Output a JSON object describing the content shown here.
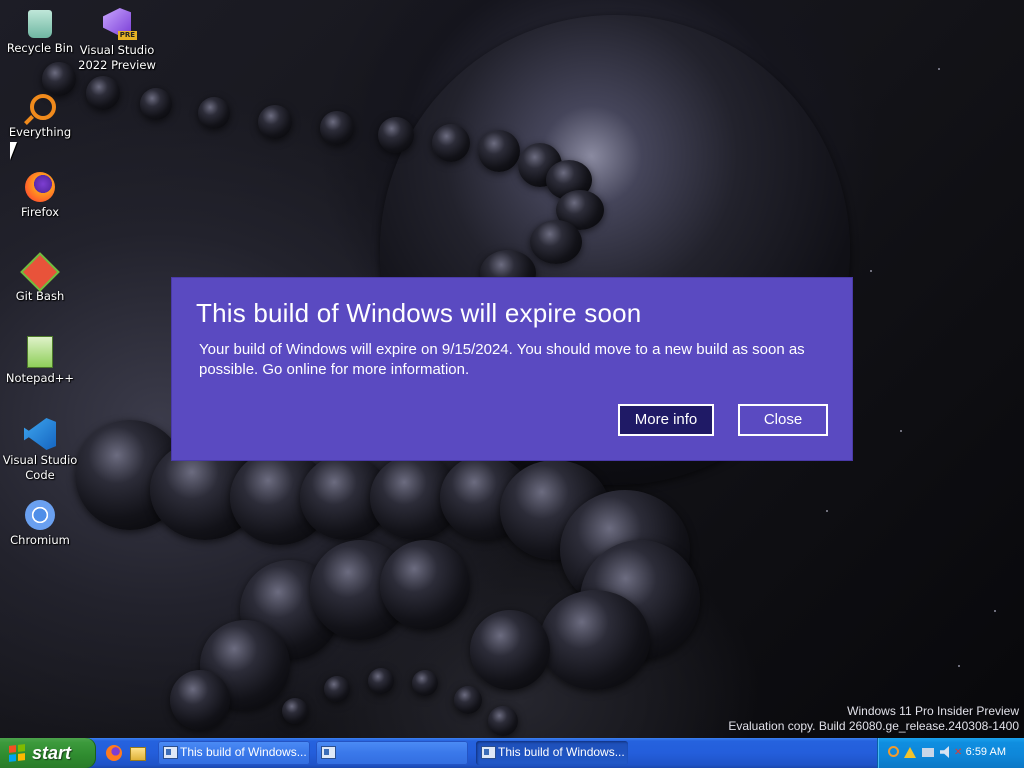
{
  "desktop": {
    "icons": [
      {
        "label": "Recycle Bin",
        "icon": "recycle-bin-icon"
      },
      {
        "label": "Visual Studio 2022 Preview",
        "icon": "visual-studio-preview-icon",
        "badge": "PRE"
      },
      {
        "label": "Everything",
        "icon": "everything-search-icon"
      },
      {
        "label": "Firefox",
        "icon": "firefox-icon"
      },
      {
        "label": "Git Bash",
        "icon": "git-bash-icon"
      },
      {
        "label": "Notepad++",
        "icon": "notepad-plus-plus-icon"
      },
      {
        "label": "Visual Studio Code",
        "icon": "vscode-icon"
      },
      {
        "label": "Chromium",
        "icon": "chromium-icon"
      }
    ]
  },
  "dialog": {
    "title": "This build of Windows will expire soon",
    "body": "Your build of Windows will expire on 9/15/2024. You should move to a new build as soon as possible. Go online for more information.",
    "more_info_label": "More info",
    "close_label": "Close",
    "background_color": "#5a4ac1",
    "primary_button_color": "#1f1a66"
  },
  "watermark": {
    "line1": "Windows 11 Pro Insider Preview",
    "line2": "Evaluation copy. Build 26080.ge_release.240308-1400"
  },
  "taskbar": {
    "start_label": "start",
    "quick_launch": [
      {
        "icon": "firefox-icon"
      },
      {
        "icon": "file-explorer-icon"
      }
    ],
    "tasks": [
      {
        "label": "This build of Windows...",
        "icon": "window-icon",
        "active": false
      },
      {
        "label": "",
        "icon": "window-icon",
        "active": false
      },
      {
        "label": "This build of Windows...",
        "icon": "window-icon",
        "active": true
      }
    ],
    "tray": {
      "icons": [
        "search-icon",
        "warning-icon",
        "network-icon",
        "volume-icon",
        "volume-muted-icon"
      ],
      "time": "6:59 AM"
    }
  }
}
